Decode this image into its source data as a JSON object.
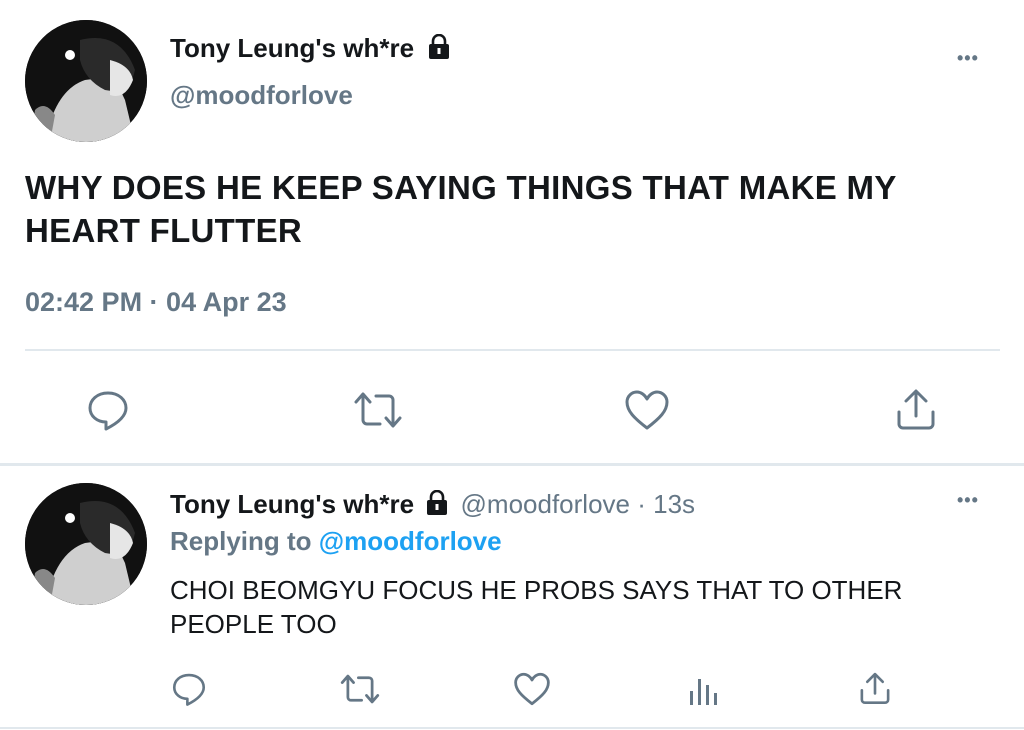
{
  "main_tweet": {
    "display_name": "Tony Leung's wh*re",
    "handle": "@moodforlove",
    "text_line1": "WHY DOES HE KEEP SAYING THINGS THAT MAKE MY",
    "text_line2": "HEART FLUTTER",
    "timestamp": "02:42 PM · 04 Apr 23",
    "more_label": "•••",
    "actions": [
      "reply-icon",
      "retweet-icon",
      "like-icon",
      "share-icon"
    ]
  },
  "reply_tweet": {
    "display_name": "Tony Leung's wh*re",
    "handle_time": "@moodforlove · 13s",
    "replying_prefix": "Replying to",
    "replying_handle": "@moodforlove",
    "text_line1": "CHOI BEOMGYU FOCUS HE PROBS SAYS THAT TO OTHER",
    "text_line2": "PEOPLE TOO",
    "more_label": "•••",
    "actions": [
      "reply-icon",
      "retweet-icon",
      "like-icon",
      "analytics-icon",
      "share-icon"
    ]
  },
  "colors": {
    "text": "#14171a",
    "secondary": "#657786",
    "link": "#1da1f2",
    "divider": "#e1e8ed"
  }
}
